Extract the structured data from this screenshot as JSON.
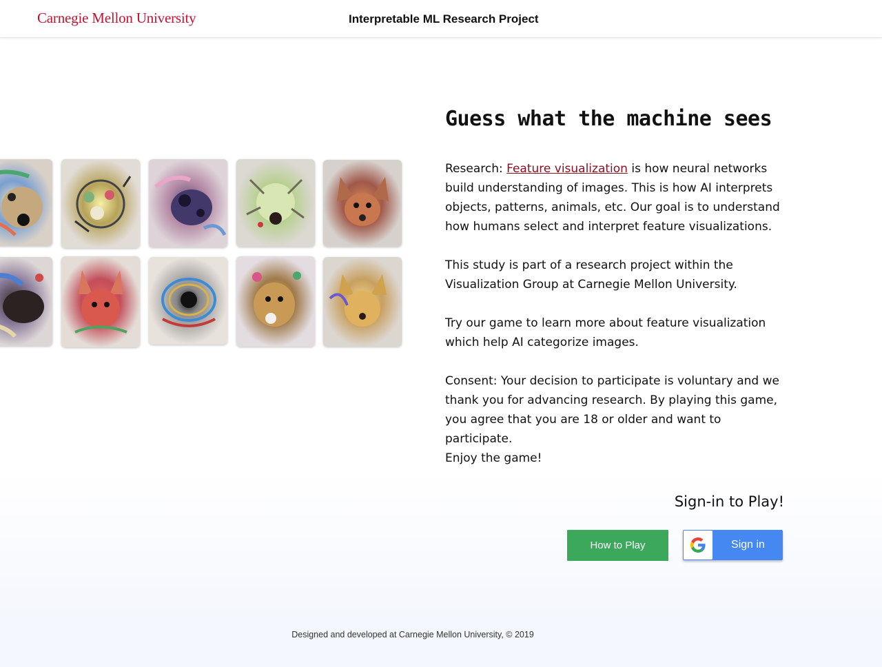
{
  "header": {
    "logo_text": "Carnegie Mellon University",
    "project_title": "Interpretable ML Research Project"
  },
  "gallery": {
    "image_count": 10
  },
  "main": {
    "heading": "Guess what the machine sees",
    "research_prefix": "Research: ",
    "research_link": "Feature visualization",
    "research_suffix": " is how neural networks build understanding of images. This is how AI interprets objects, patterns, animals, etc. Our goal is to understand how humans select and interpret feature visualizations.",
    "study_text": "This study is part of a research project within the Visualization Group at Carnegie Mellon University.",
    "game_text": "Try our game to learn more about feature visualization which help AI categorize images.",
    "consent_text": "Consent: Your decision to participate is voluntary and we thank you for advancing research.  By playing this game, you agree that you are 18 or older and want to participate.",
    "enjoy_text": "Enjoy the game!"
  },
  "signin": {
    "heading": "Sign-in to Play!",
    "how_to_play_label": "How to Play",
    "google_label": "Sign in"
  },
  "footer": {
    "text": "Designed and developed at Carnegie Mellon University, © 2019"
  },
  "colors": {
    "brand_red": "#c41230",
    "link_red": "#8a0f1f",
    "how_to_play_green": "#3ba85b",
    "google_blue": "#4688f1"
  }
}
